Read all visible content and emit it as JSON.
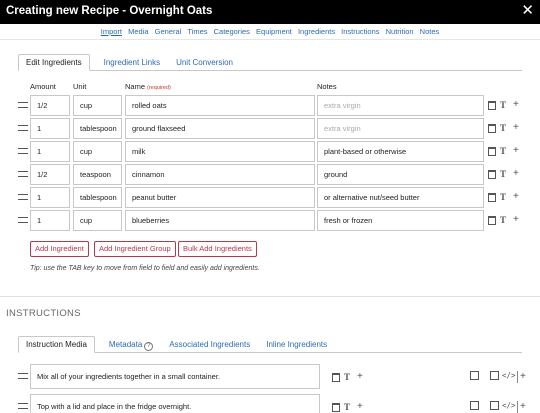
{
  "title": "Creating new Recipe - Overnight Oats",
  "close_glyph": "✕",
  "nav": [
    "Import",
    "Media",
    "General",
    "Times",
    "Categories",
    "Equipment",
    "Ingredients",
    "Instructions",
    "Nutrition",
    "Notes"
  ],
  "ingredient_tabs": [
    "Edit Ingredients",
    "Ingredient Links",
    "Unit Conversion"
  ],
  "columns": {
    "amount": "Amount",
    "unit": "Unit",
    "name": "Name",
    "required": "(required)",
    "notes": "Notes"
  },
  "ingredients": [
    {
      "amount": "1/2",
      "unit": "cup",
      "name": "rolled oats",
      "notes": "extra virgin",
      "notes_placeholder": true
    },
    {
      "amount": "1",
      "unit": "tablespoon",
      "name": "ground flaxseed",
      "notes": "extra virgin",
      "notes_placeholder": true
    },
    {
      "amount": "1",
      "unit": "cup",
      "name": "milk",
      "notes": "plant-based or otherwise",
      "notes_placeholder": false
    },
    {
      "amount": "1/2",
      "unit": "teaspoon",
      "name": "cinnamon",
      "notes": "ground",
      "notes_placeholder": false
    },
    {
      "amount": "1",
      "unit": "tablespoon",
      "name": "peanut butter",
      "notes": "or alternative nut/seed butter",
      "notes_placeholder": false
    },
    {
      "amount": "1",
      "unit": "cup",
      "name": "blueberries",
      "notes": "fresh or frozen",
      "notes_placeholder": false
    }
  ],
  "buttons": {
    "add_ingredient": "Add Ingredient",
    "add_group": "Add Ingredient Group",
    "bulk_add": "Bulk Add Ingredients"
  },
  "tip": "Tip: use the TAB key to move from field to field and easily add ingredients.",
  "instructions_heading": "INSTRUCTIONS",
  "instruction_tabs": [
    "Instruction Media",
    "Metadata",
    "Associated Ingredients",
    "Inline Ingredients"
  ],
  "help_glyph": "?",
  "instructions": [
    "Mix all of your ingredients together in a small container.",
    "Top with a lid and place in the fridge overnight."
  ],
  "icons": {
    "trash": "trash-icon",
    "text": "text-format-icon",
    "plus": "plus-icon",
    "image": "image-icon",
    "code": "code-icon"
  },
  "colors": {
    "titlebar": "#000000",
    "link": "#2d6bb3",
    "button": "#b5394a",
    "required": "#c0392b"
  }
}
